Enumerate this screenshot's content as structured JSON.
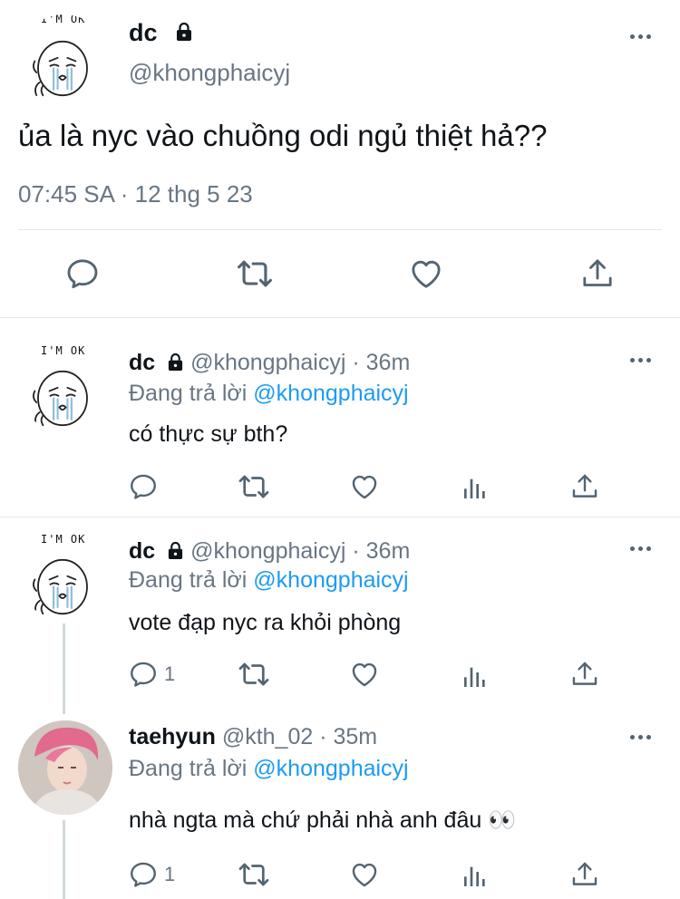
{
  "main_tweet": {
    "display_name": "dc",
    "handle": "@khongphaicyj",
    "text": "ủa là nyc vào chuồng odi ngủ thiệt hả??",
    "timestamp": "07:45 SA · 12 thg 5 23",
    "avatar_caption": "I'M OK"
  },
  "replies": [
    {
      "display_name": "dc",
      "handle": "@khongphaicyj",
      "age": "· 36m",
      "replying_prefix": "Đang trả lời",
      "replying_to": "@khongphaicyj",
      "text": "có thực sự bth?",
      "reply_count": "",
      "avatar_caption": "I'M OK"
    },
    {
      "display_name": "dc",
      "handle": "@khongphaicyj",
      "age": "· 36m",
      "replying_prefix": "Đang trả lời",
      "replying_to": "@khongphaicyj",
      "text": "vote đạp nyc ra khỏi phòng",
      "reply_count": "1",
      "avatar_caption": "I'M OK"
    },
    {
      "display_name": "taehyun",
      "handle": "@kth_02",
      "age": "· 35m",
      "replying_prefix": "Đang trả lời",
      "replying_to": "@khongphaicyj",
      "text": "nhà ngta mà chứ phải nhà anh đâu 👀",
      "reply_count": "1"
    }
  ],
  "colors": {
    "link": "#1d9bf0",
    "secondary_text": "#687684",
    "icon": "#536471",
    "divider": "#e1e8ed"
  },
  "icons": [
    "lock-icon",
    "more-icon",
    "reply-icon",
    "retweet-icon",
    "like-icon",
    "share-icon",
    "analytics-icon"
  ]
}
